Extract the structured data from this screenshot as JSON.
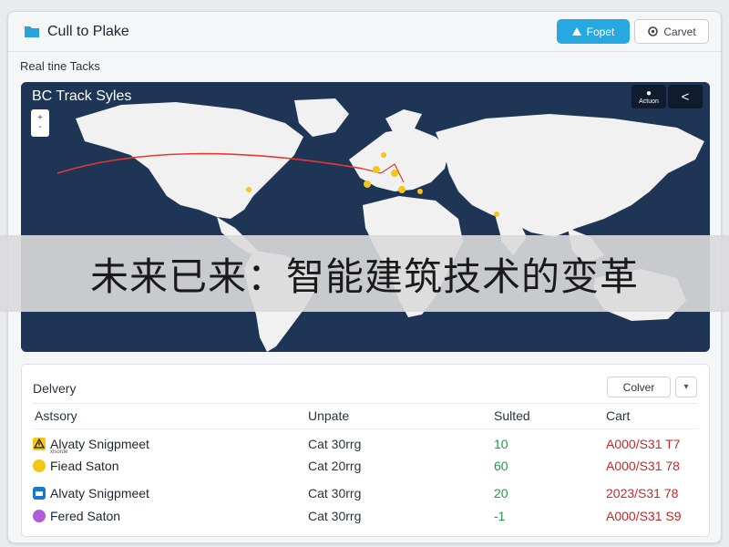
{
  "app": {
    "title": "Cull to Plake",
    "primary_button": "Fopet",
    "secondary_button": "Carvet",
    "accent_color": "#25a9e0"
  },
  "section_label": "Real tine Tacks",
  "map": {
    "title": "BC Track Syles",
    "zoom_plus": "+",
    "zoom_minus": "-",
    "action_button_label": "Actuon",
    "back_button_glyph": "<",
    "ocean_color": "#1e3556",
    "land_color": "#f1f1f1",
    "route_color": "#e53935",
    "marker_color": "#f5c518"
  },
  "overlay_banner": "未来已来：智能建筑技术的变革",
  "delivery": {
    "title": "Delvery",
    "button_label": "Colver",
    "dropdown_glyph": "▾",
    "columns": [
      "Astsory",
      "Unpate",
      "Sulted",
      "Cart"
    ],
    "rows": [
      {
        "icon": "warning-icon",
        "icon_color": "#f5c518",
        "name": "Alvaty Snigpmeet",
        "sub": "xlsorde",
        "updated": "Cat 30rrg",
        "sold": "10",
        "cart": "A000/S31 T7"
      },
      {
        "icon": "circle-icon",
        "icon_color": "#f5c518",
        "name": "Fiead Saton",
        "sub": "",
        "updated": "Cat 20rrg",
        "sold": "60",
        "cart": "A000/S31 78"
      },
      {
        "icon": "box-icon",
        "icon_color": "#1976d2",
        "name": "Alvaty Snigpmeet",
        "sub": "",
        "updated": "Cat 30rrg",
        "sold": "20",
        "cart": "2023/S31 78"
      },
      {
        "icon": "circle-icon",
        "icon_color": "#b05cd6",
        "name": "Fered Saton",
        "sub": "",
        "updated": "Cat 30rrg",
        "sold": "-1",
        "cart": "A000/S31 S9"
      }
    ]
  }
}
